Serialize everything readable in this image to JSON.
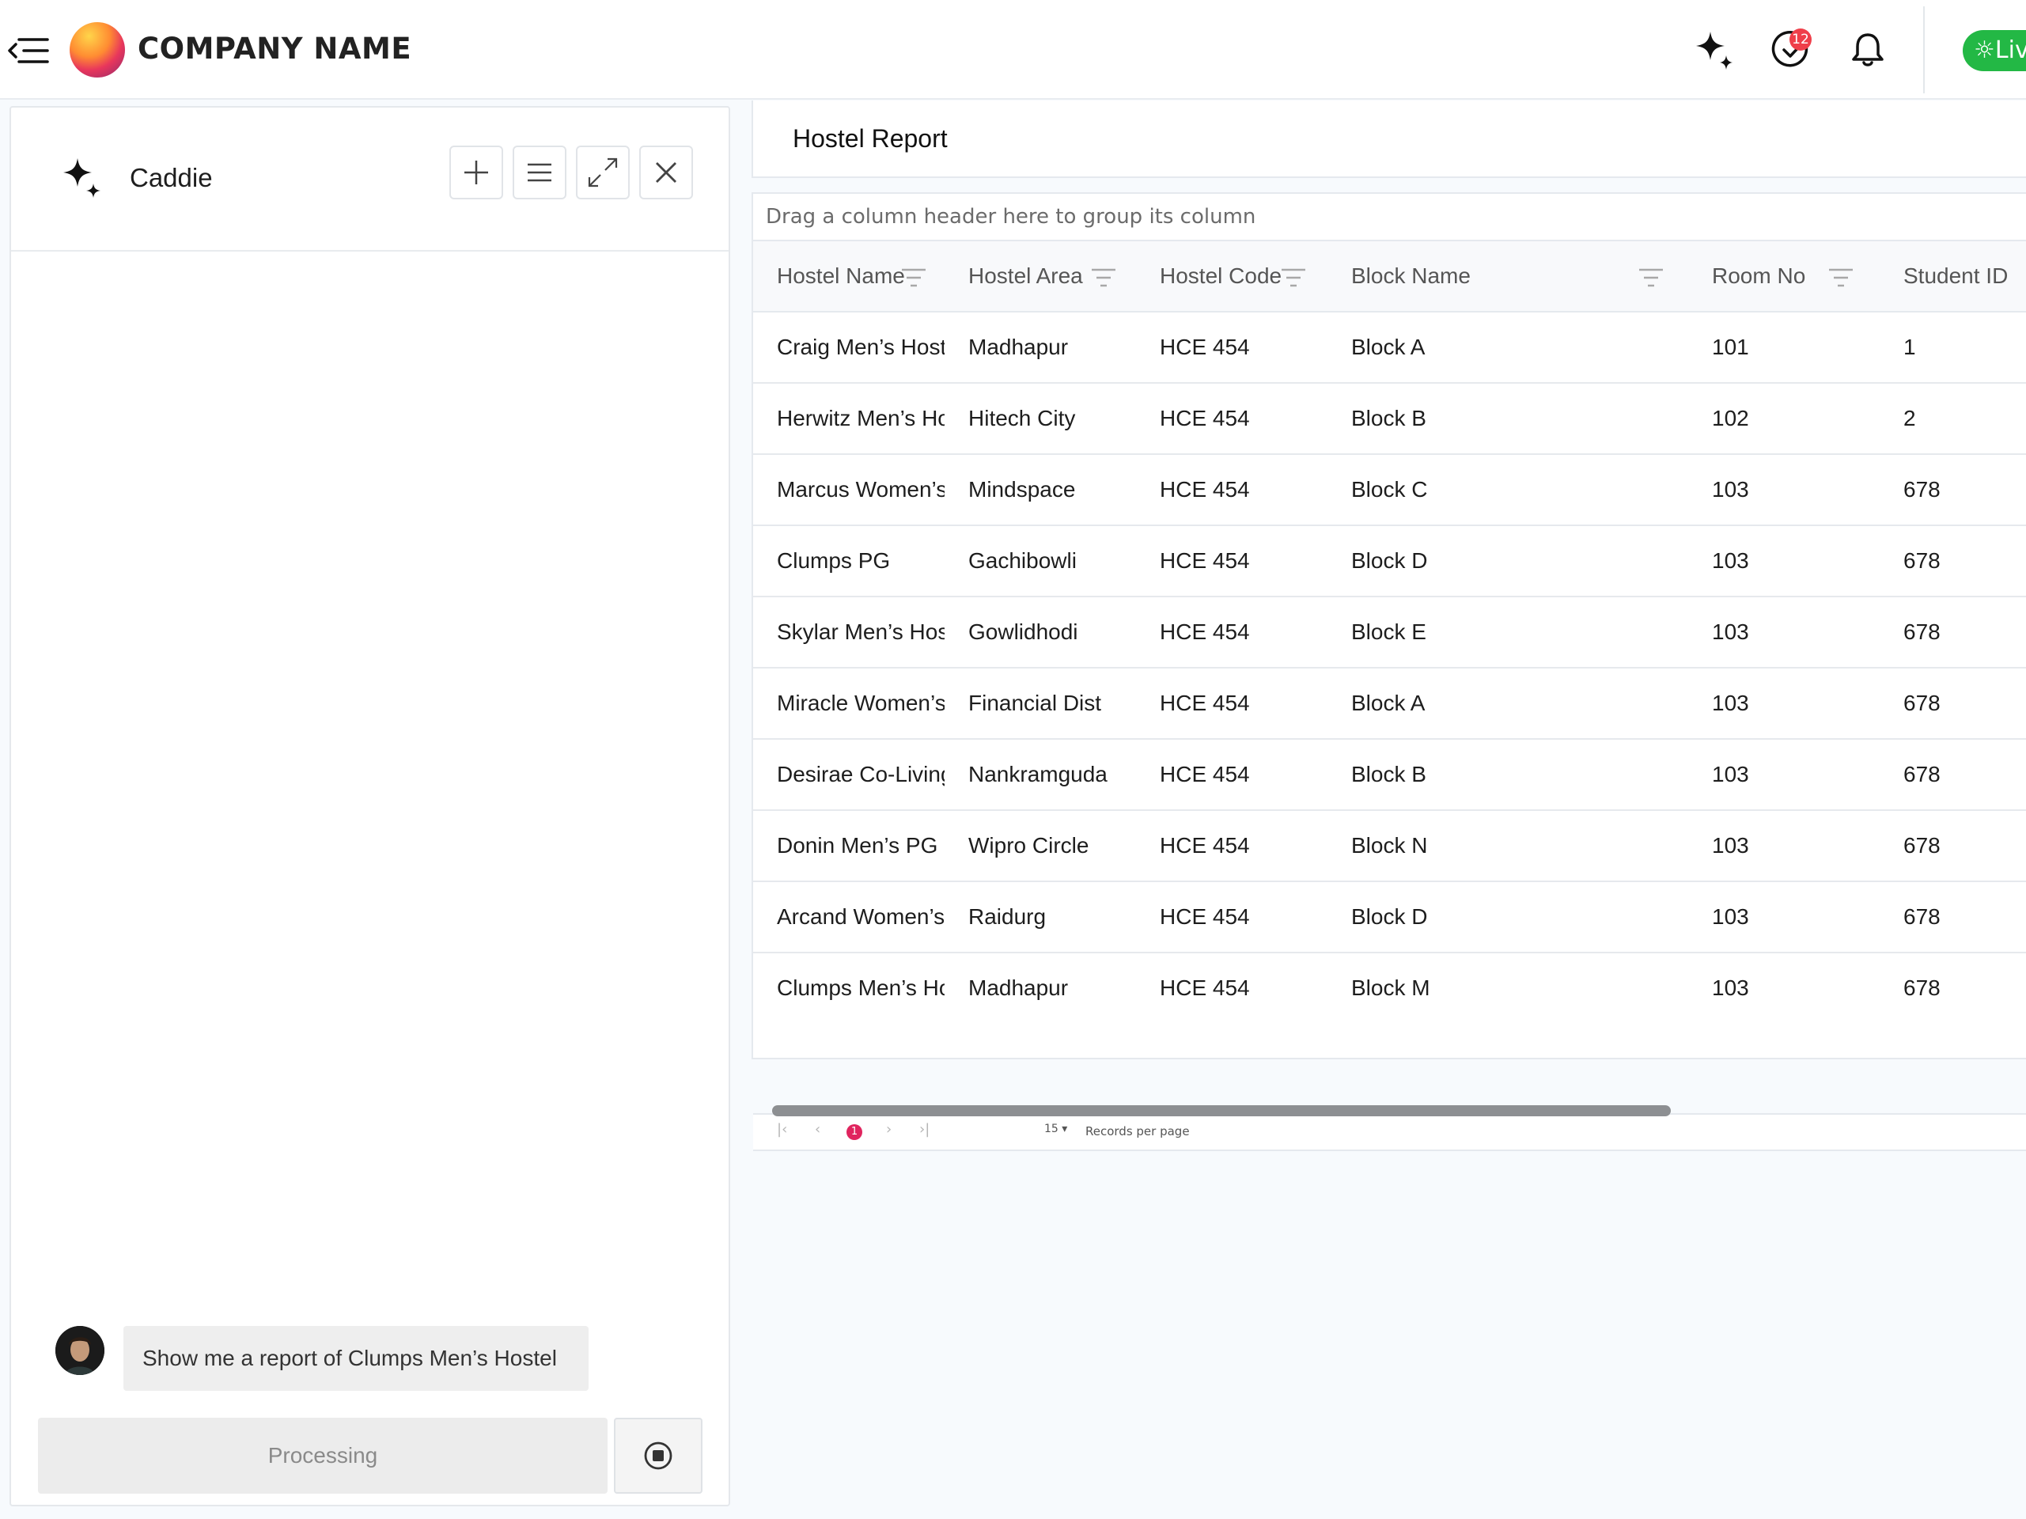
{
  "header": {
    "company_name": "COMPANY NAME",
    "notification_count": "12",
    "live_label": "Liv",
    "icons": [
      "menu-collapse-icon",
      "sparkle-icon",
      "task-check-icon",
      "bell-icon",
      "sun-icon"
    ]
  },
  "caddie": {
    "title": "Caddie",
    "buttons": [
      "add-icon",
      "list-icon",
      "expand-icon",
      "close-icon"
    ],
    "user_message": "Show me a report of Clumps Men’s Hostel",
    "processing_label": "Processing"
  },
  "report": {
    "title": "Hostel Report",
    "group_hint": "Drag a column header here to group its column",
    "columns": [
      "Hostel Name",
      "Hostel Area",
      "Hostel Code",
      "Block Name",
      "Room No",
      "Student ID"
    ],
    "rows": [
      [
        "Craig Men’s Hostel",
        "Madhapur",
        "HCE 454",
        "Block A",
        "101",
        "1"
      ],
      [
        "Herwitz Men’s Hostel",
        "Hitech City",
        "HCE 454",
        "Block B",
        "102",
        "2"
      ],
      [
        "Marcus Women’s Hostel",
        "Mindspace",
        "HCE 454",
        "Block C",
        "103",
        "678"
      ],
      [
        "Clumps PG",
        "Gachibowli",
        "HCE 454",
        "Block D",
        "103",
        "678"
      ],
      [
        "Skylar Men’s Hostel",
        "Gowlidhodi",
        "HCE 454",
        "Block E",
        "103",
        "678"
      ],
      [
        "Miracle Women’s Hostel",
        "Financial Dist",
        "HCE 454",
        "Block A",
        "103",
        "678"
      ],
      [
        "Desirae Co-Living",
        "Nankramguda",
        "HCE 454",
        "Block B",
        "103",
        "678"
      ],
      [
        "Donin Men’s PG",
        "Wipro Circle",
        "HCE 454",
        "Block N",
        "103",
        "678"
      ],
      [
        "Arcand Women’s Hostel",
        "Raidurg",
        "HCE 454",
        "Block D",
        "103",
        "678"
      ],
      [
        "Clumps Men’s Hostel",
        "Madhapur",
        "HCE 454",
        "Block M",
        "103",
        "678"
      ]
    ],
    "pager": {
      "current_page": "1",
      "page_size": "15",
      "page_size_label": "Records per page"
    }
  },
  "colors": {
    "accent_pink": "#e0245e",
    "live_green": "#23b845",
    "badge_red": "#ef3f4a"
  }
}
